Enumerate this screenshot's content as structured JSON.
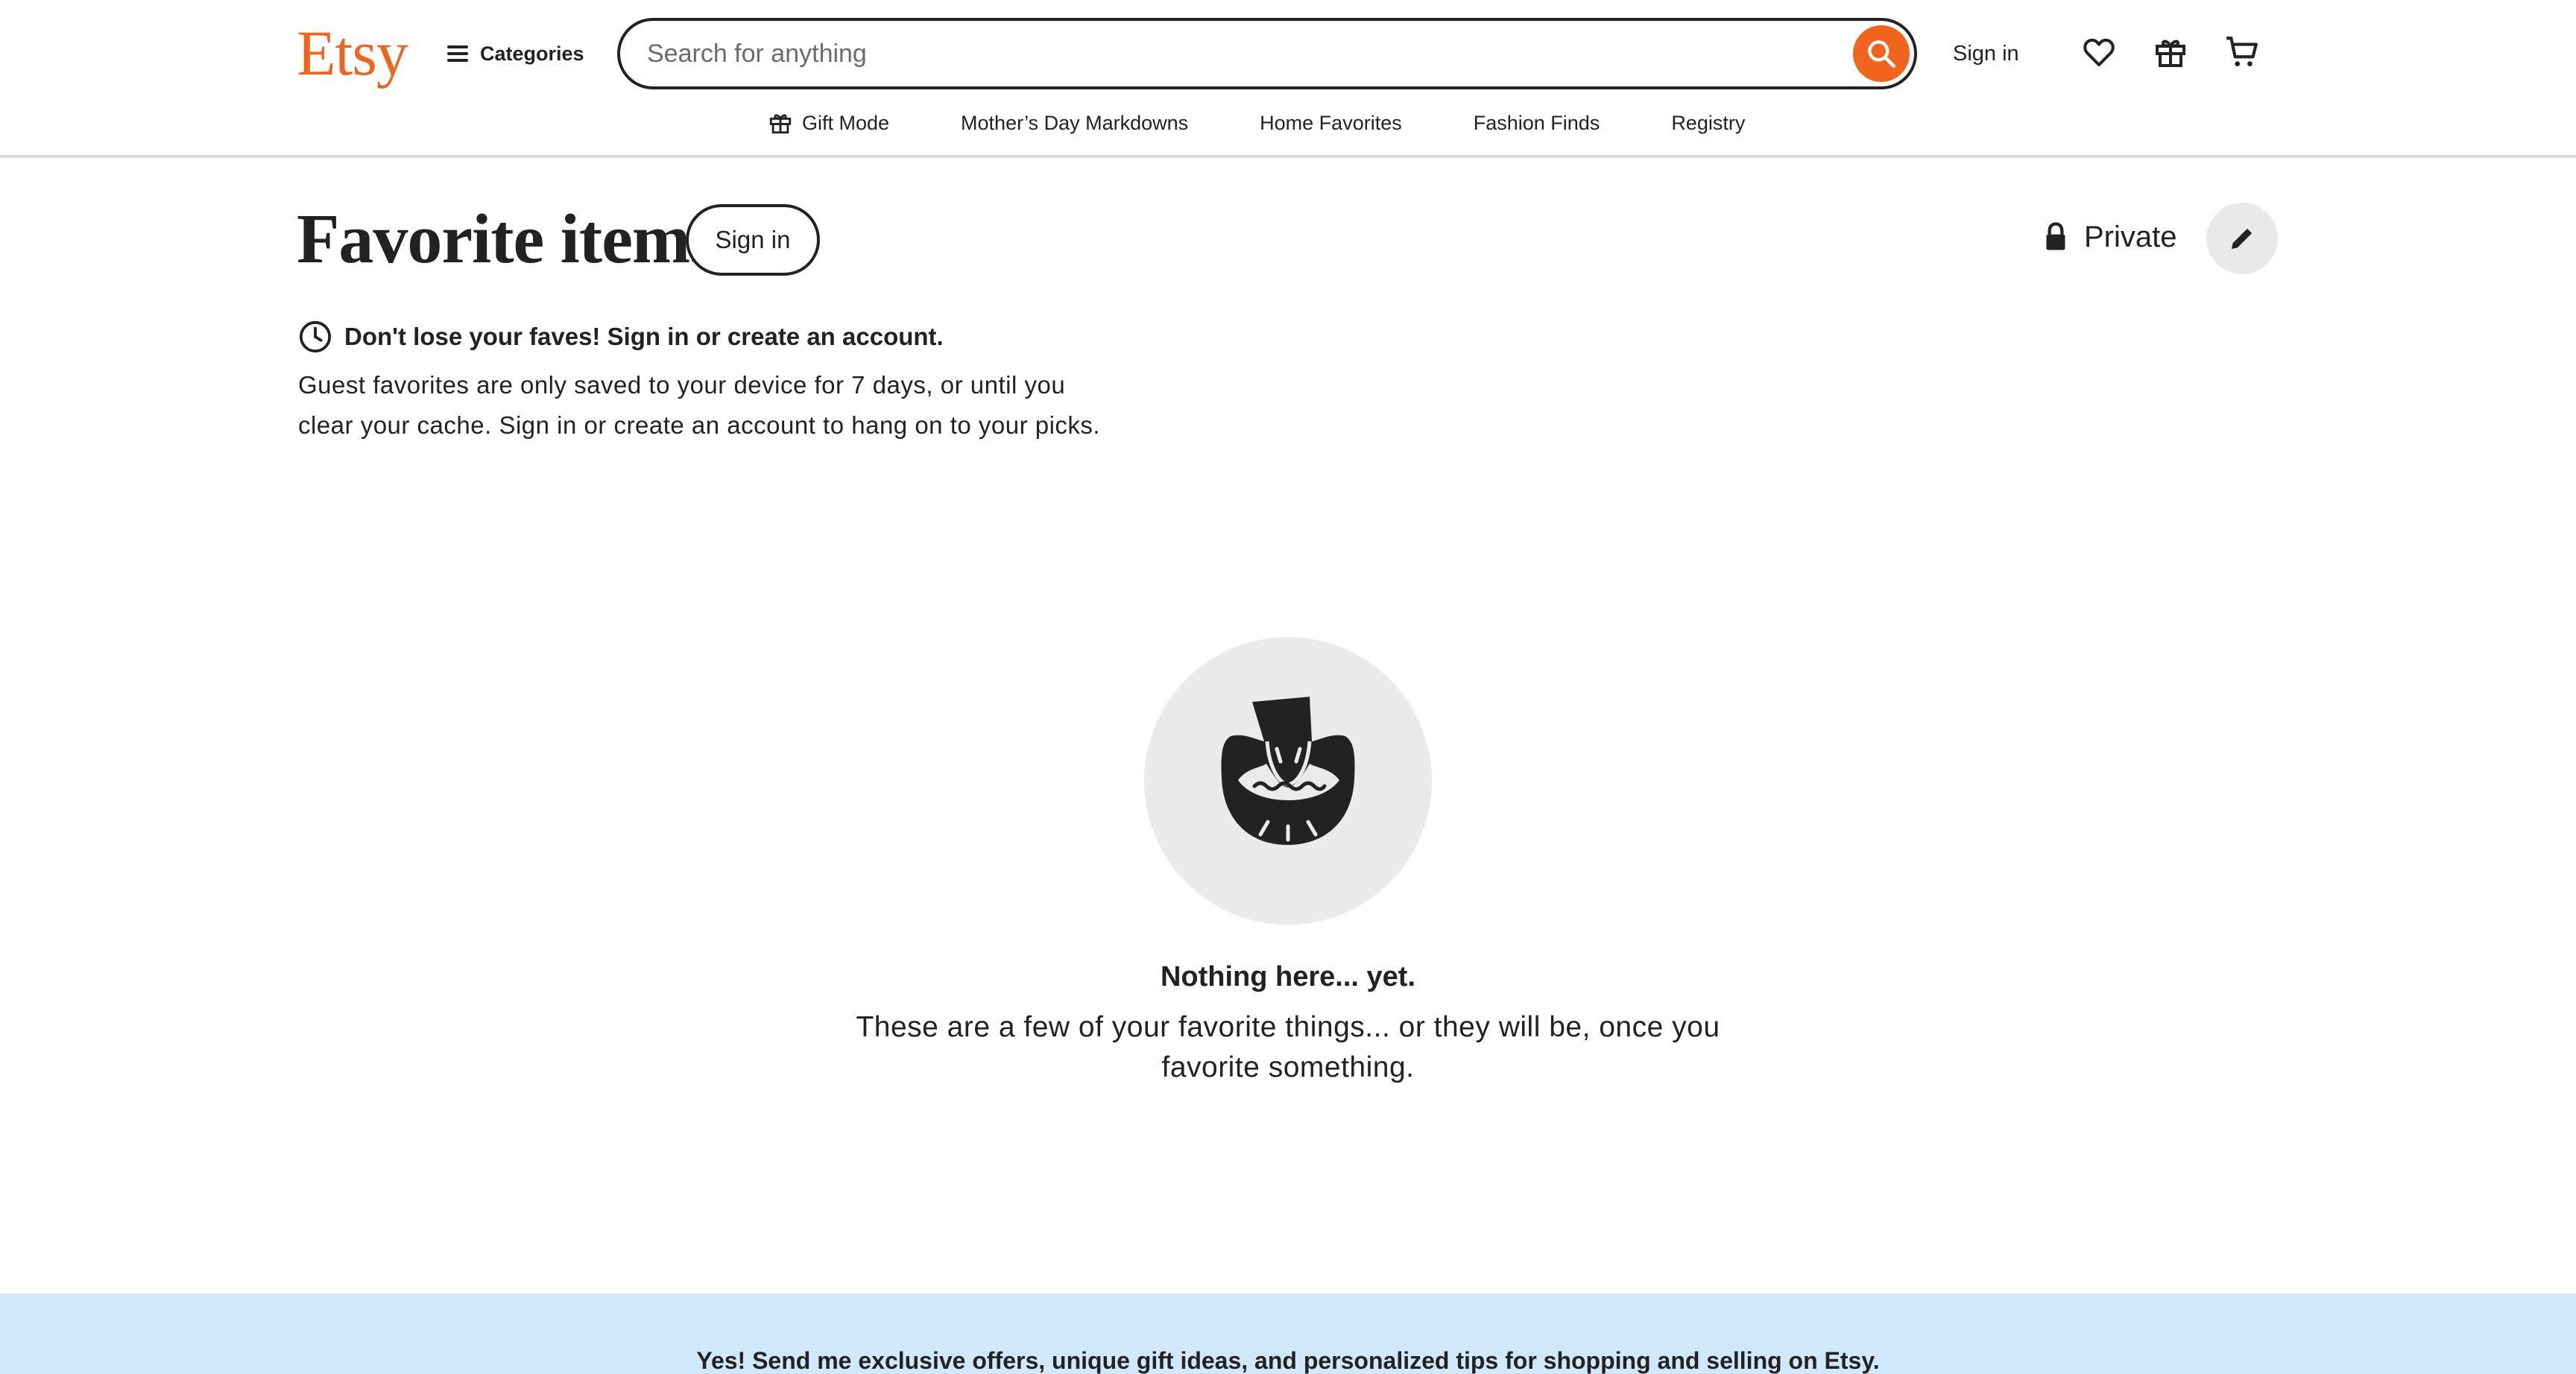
{
  "header": {
    "logo": "Etsy",
    "categories_label": "Categories",
    "search": {
      "placeholder": "Search for anything",
      "value": ""
    },
    "sign_in": "Sign in",
    "icons": [
      "hamburger-icon",
      "search-icon",
      "heart-icon",
      "gift-icon",
      "cart-icon"
    ]
  },
  "subnav": {
    "items": [
      {
        "label": "Gift Mode",
        "icon": "gift-icon"
      },
      {
        "label": "Mother’s Day Markdowns"
      },
      {
        "label": "Home Favorites"
      },
      {
        "label": "Fashion Finds"
      },
      {
        "label": "Registry"
      }
    ]
  },
  "main": {
    "title": "Favorite items",
    "title_signin": "Sign in",
    "privacy_label": "Private",
    "notice": {
      "heading": "Don't lose your faves! Sign in or create an account.",
      "body": "Guest favorites are only saved to your device for 7 days, or until you clear your cache. Sign in or create an account to hang on to your picks."
    },
    "empty_state": {
      "title": "Nothing here... yet.",
      "text": "These are a few of your favorite things... or they will be, once you favorite something."
    }
  },
  "footer": {
    "newsletter_text": "Yes! Send me exclusive offers, unique gift ideas, and personalized tips for shopping and selling on Etsy."
  },
  "colors": {
    "brand": "#f1641e",
    "text": "#222222",
    "footer_band": "#d1e8fb",
    "empty_circle": "#eaeaea"
  }
}
